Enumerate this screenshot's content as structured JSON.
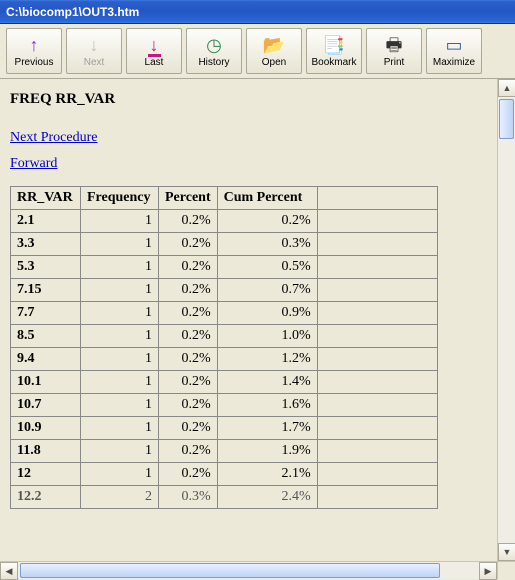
{
  "window": {
    "title": "C:\\biocomp1\\OUT3.htm"
  },
  "toolbar": [
    {
      "name": "previous",
      "label": "Previous",
      "icon": "↑",
      "color": "#8a2be2",
      "enabled": true
    },
    {
      "name": "next",
      "label": "Next",
      "icon": "↓",
      "color": "#c0c0c0",
      "enabled": false
    },
    {
      "name": "last",
      "label": "Last",
      "icon": "↓",
      "color": "#c71585",
      "enabled": true,
      "bar": true
    },
    {
      "name": "history",
      "label": "History",
      "icon": "◷",
      "color": "#2e8b57",
      "enabled": true
    },
    {
      "name": "open",
      "label": "Open",
      "icon": "📂",
      "color": "#c9a227",
      "enabled": true
    },
    {
      "name": "bookmark",
      "label": "Bookmark",
      "icon": "📑",
      "color": "#2e8b57",
      "enabled": true
    },
    {
      "name": "print",
      "label": "Print",
      "icon": "🖶",
      "color": "#333",
      "enabled": true
    },
    {
      "name": "maximize",
      "label": "Maximize",
      "icon": "▭",
      "color": "#3b5fa0",
      "enabled": true
    }
  ],
  "content": {
    "heading": "FREQ RR_VAR",
    "links": {
      "next_procedure": "Next Procedure",
      "forward": "Forward"
    },
    "columns": {
      "rr_var": "RR_VAR",
      "frequency": "Frequency",
      "percent": "Percent",
      "cum_percent": "Cum Percent"
    },
    "rows": [
      {
        "rr": "2.1",
        "freq": "1",
        "pct": "0.2%",
        "cum": "0.2%"
      },
      {
        "rr": "3.3",
        "freq": "1",
        "pct": "0.2%",
        "cum": "0.3%"
      },
      {
        "rr": "5.3",
        "freq": "1",
        "pct": "0.2%",
        "cum": "0.5%"
      },
      {
        "rr": "7.15",
        "freq": "1",
        "pct": "0.2%",
        "cum": "0.7%"
      },
      {
        "rr": "7.7",
        "freq": "1",
        "pct": "0.2%",
        "cum": "0.9%"
      },
      {
        "rr": "8.5",
        "freq": "1",
        "pct": "0.2%",
        "cum": "1.0%"
      },
      {
        "rr": "9.4",
        "freq": "1",
        "pct": "0.2%",
        "cum": "1.2%"
      },
      {
        "rr": "10.1",
        "freq": "1",
        "pct": "0.2%",
        "cum": "1.4%"
      },
      {
        "rr": "10.7",
        "freq": "1",
        "pct": "0.2%",
        "cum": "1.6%"
      },
      {
        "rr": "10.9",
        "freq": "1",
        "pct": "0.2%",
        "cum": "1.7%"
      },
      {
        "rr": "11.8",
        "freq": "1",
        "pct": "0.2%",
        "cum": "1.9%"
      },
      {
        "rr": "12",
        "freq": "1",
        "pct": "0.2%",
        "cum": "2.1%"
      },
      {
        "rr": "12.2",
        "freq": "2",
        "pct": "0.3%",
        "cum": "2.4%"
      }
    ]
  }
}
